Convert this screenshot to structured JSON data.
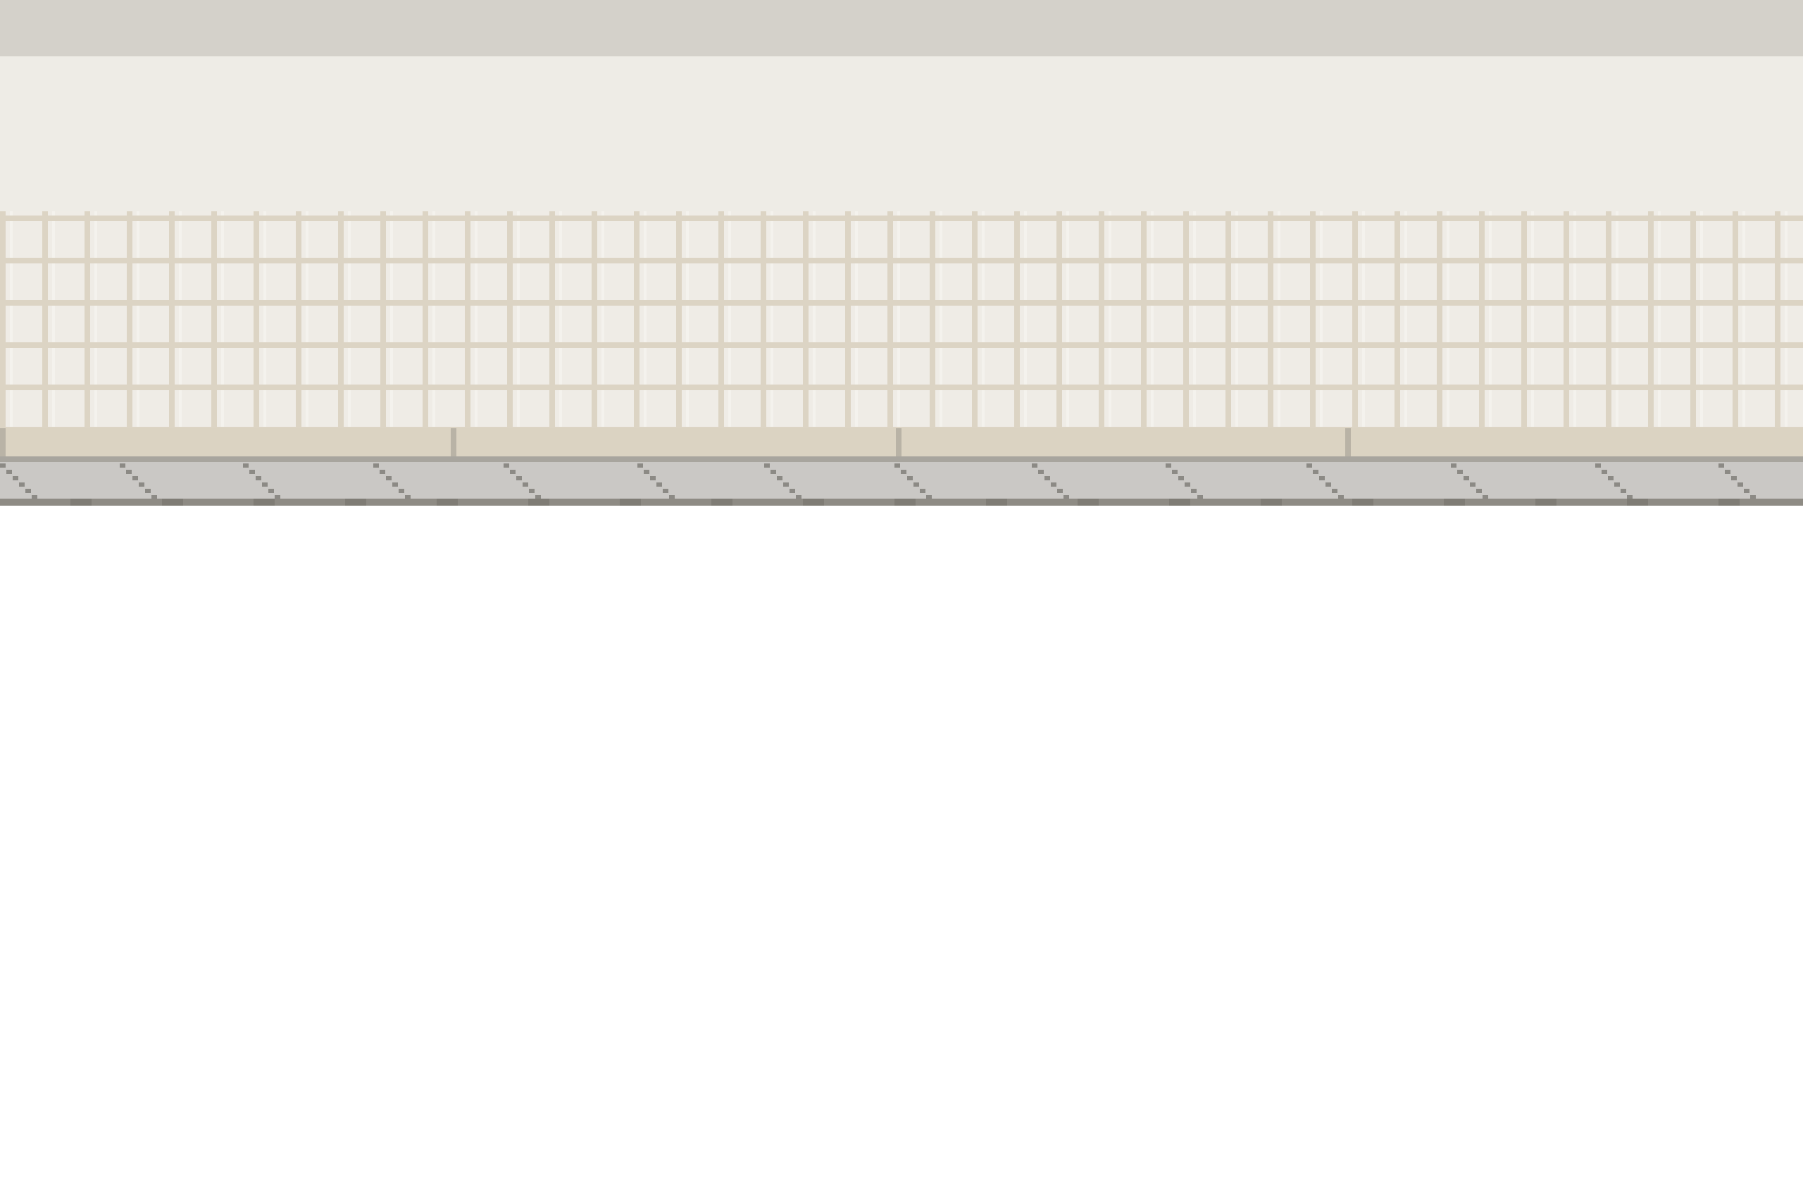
{
  "scene": {
    "colors": {
      "ceiling": "#d4d1ca",
      "wall_panel": "#eeece6",
      "tile_face": "#efece6",
      "tile_grout": "#dcd4c4",
      "baseboard": "#dbd3c2",
      "baseboard_divider": "#b9b3a6",
      "floor": "#cac8c5",
      "floor_hatch": "#8c8a85",
      "floor_edge": "#8e8b84",
      "void": "#ffffff"
    },
    "tile_grid": {
      "rows": 5,
      "columns": 43
    },
    "baseboard_segments": 4,
    "floor_hatch_marks": 14
  }
}
